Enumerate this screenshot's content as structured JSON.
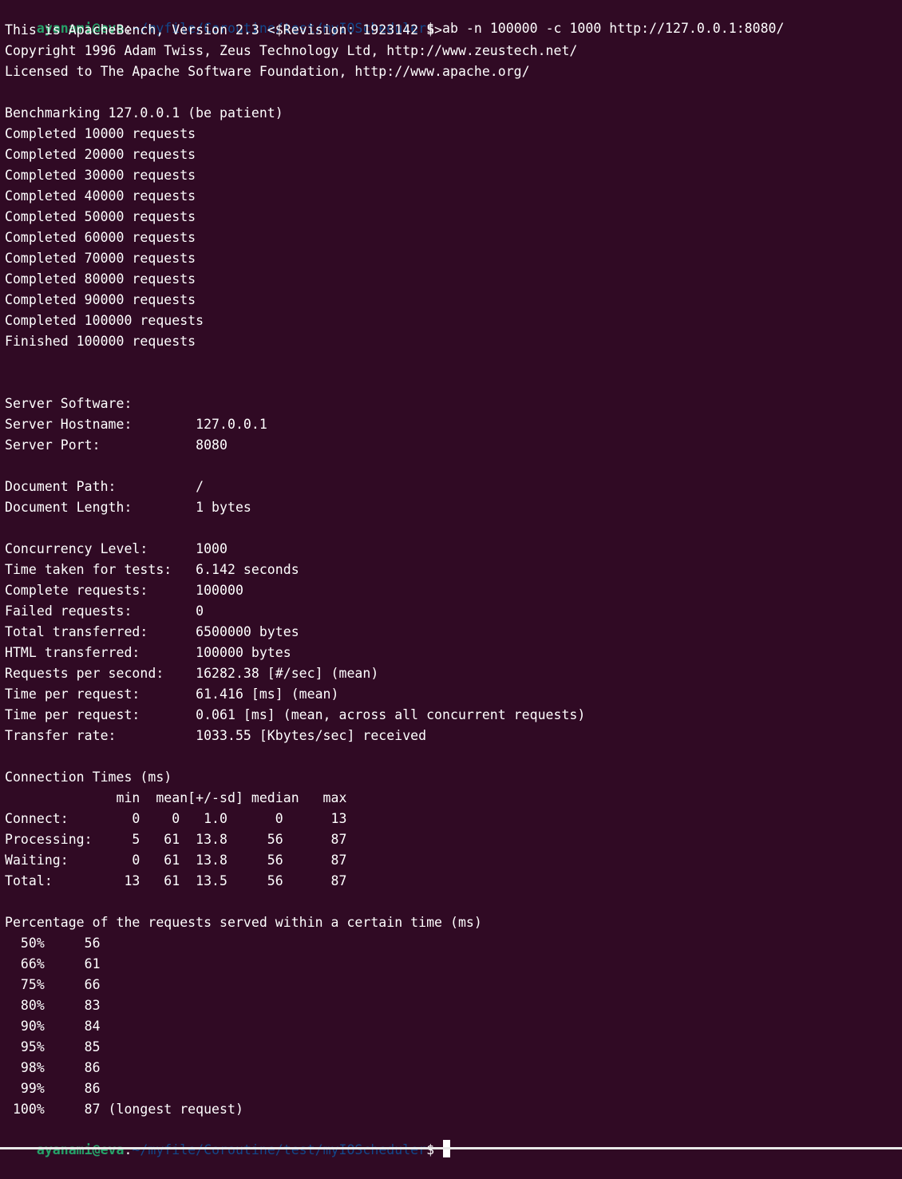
{
  "window": {
    "background": "#300a24",
    "user_color": "#26a269",
    "path_color": "#12488b",
    "text_color": "#ffffff"
  },
  "prompt": {
    "user_host": "ayanami@eva",
    "colon": ":",
    "path": "~/myfile/Coroutine/test/myIOScheduler",
    "symbol": "$"
  },
  "command": " ab -n 100000 -c 1000 http://127.0.0.1:8080/",
  "output_lines": [
    "This is ApacheBench, Version 2.3 <$Revision: 1923142 $>",
    "Copyright 1996 Adam Twiss, Zeus Technology Ltd, http://www.zeustech.net/",
    "Licensed to The Apache Software Foundation, http://www.apache.org/",
    "",
    "Benchmarking 127.0.0.1 (be patient)",
    "Completed 10000 requests",
    "Completed 20000 requests",
    "Completed 30000 requests",
    "Completed 40000 requests",
    "Completed 50000 requests",
    "Completed 60000 requests",
    "Completed 70000 requests",
    "Completed 80000 requests",
    "Completed 90000 requests",
    "Completed 100000 requests",
    "Finished 100000 requests",
    "",
    "",
    "Server Software:",
    "Server Hostname:        127.0.0.1",
    "Server Port:            8080",
    "",
    "Document Path:          /",
    "Document Length:        1 bytes",
    "",
    "Concurrency Level:      1000",
    "Time taken for tests:   6.142 seconds",
    "Complete requests:      100000",
    "Failed requests:        0",
    "Total transferred:      6500000 bytes",
    "HTML transferred:       100000 bytes",
    "Requests per second:    16282.38 [#/sec] (mean)",
    "Time per request:       61.416 [ms] (mean)",
    "Time per request:       0.061 [ms] (mean, across all concurrent requests)",
    "Transfer rate:          1033.55 [Kbytes/sec] received",
    "",
    "Connection Times (ms)",
    "              min  mean[+/-sd] median   max",
    "Connect:        0    0   1.0      0      13",
    "Processing:     5   61  13.8     56      87",
    "Waiting:        0   61  13.8     56      87",
    "Total:         13   61  13.5     56      87",
    "",
    "Percentage of the requests served within a certain time (ms)",
    "  50%     56",
    "  66%     61",
    "  75%     66",
    "  80%     83",
    "  90%     84",
    "  95%     85",
    "  98%     86",
    "  99%     86",
    " 100%     87 (longest request)"
  ]
}
